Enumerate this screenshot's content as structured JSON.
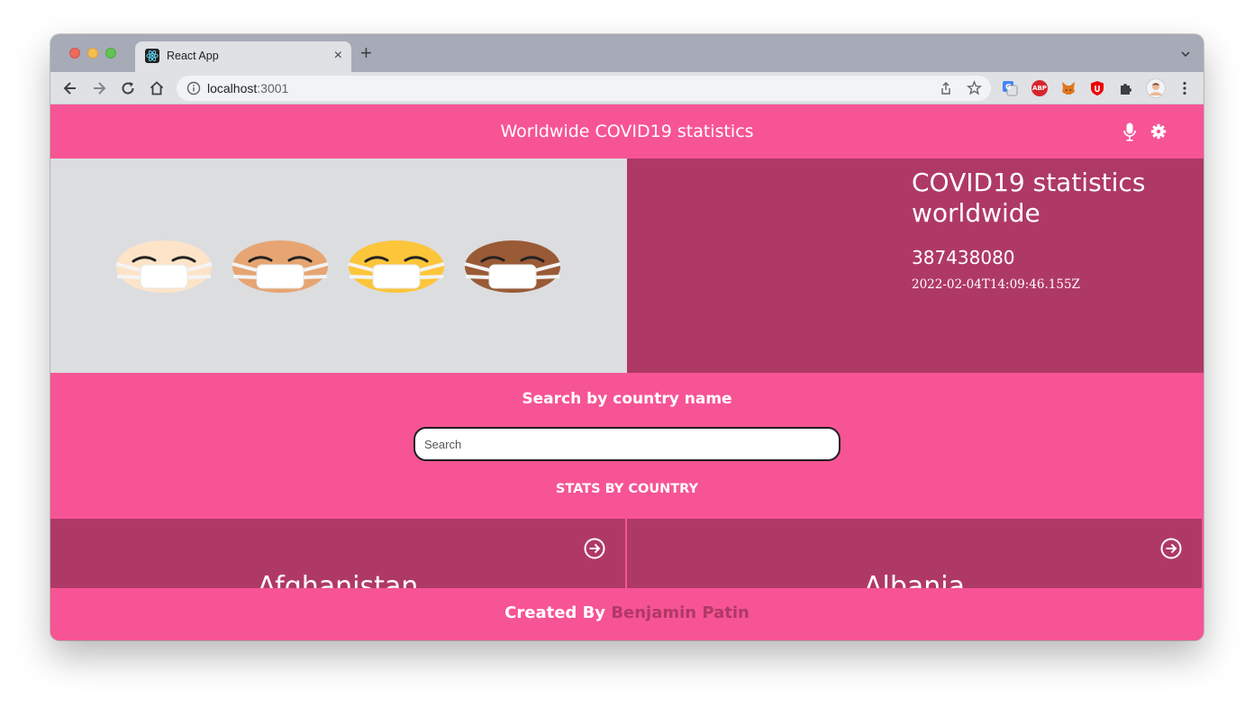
{
  "browser": {
    "tab_title": "React App",
    "new_tab_symbol": "+",
    "close_symbol": "×",
    "url_host": "localhost",
    "url_port": ":3001",
    "extensions": [
      "google-translate",
      "adblock-plus",
      "metamask",
      "ublock",
      "extensions",
      "profile"
    ],
    "ext_abp_label": "ABP"
  },
  "header": {
    "title": "Worldwide COVID19 statistics",
    "icons": [
      "mic-icon",
      "gear-icon"
    ]
  },
  "hero": {
    "heading": "COVID19 statistics worldwide",
    "total": "387438080",
    "date": "2022-02-04T14:09:46.155Z",
    "emoji_skin_tones": [
      "#fde4c8",
      "#e6a572",
      "#fcc53a",
      "#9a5a36"
    ]
  },
  "search": {
    "label": "Search by country name",
    "placeholder": "Search",
    "value": ""
  },
  "stats": {
    "label": "STATS BY COUNTRY",
    "countries": [
      {
        "name": "Afghanistan"
      },
      {
        "name": "Albania"
      }
    ]
  },
  "footer": {
    "prefix": "Created By",
    "author": "Benjamin Patin"
  },
  "colors": {
    "primary": "#f75495",
    "secondary": "#af3966",
    "hero_bg": "#dcdddf"
  }
}
